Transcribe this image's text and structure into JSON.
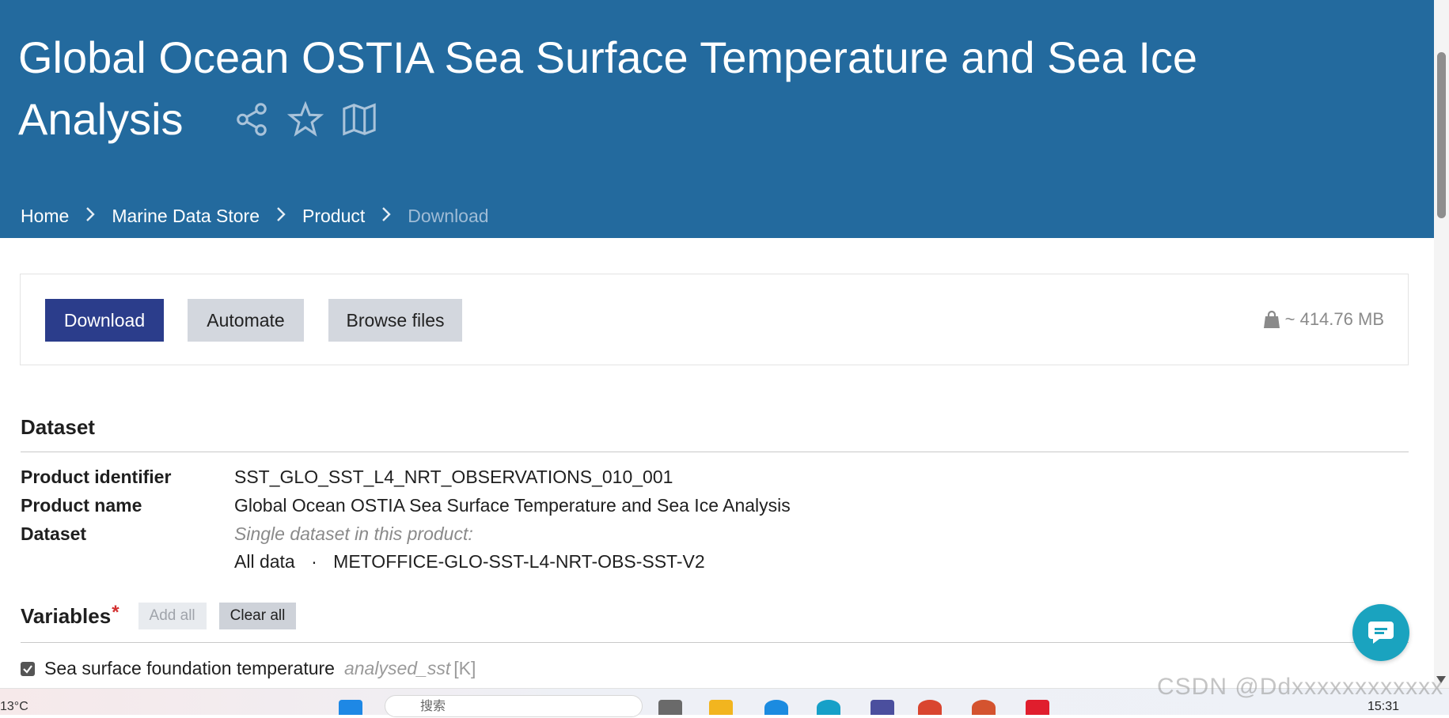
{
  "header": {
    "title_line1": "Global Ocean OSTIA Sea Surface Temperature and Sea Ice",
    "title_line2": "Analysis",
    "icons": [
      "share-icon",
      "star-icon",
      "map-icon"
    ],
    "breadcrumb": [
      "Home",
      "Marine Data Store",
      "Product",
      "Download"
    ],
    "bg_color": "#236a9e"
  },
  "actions": {
    "download_label": "Download",
    "automate_label": "Automate",
    "browse_label": "Browse files",
    "size_label": "~ 414.76 MB",
    "primary_color": "#2b3d8b"
  },
  "dataset": {
    "heading": "Dataset",
    "product_identifier_label": "Product identifier",
    "product_identifier": "SST_GLO_SST_L4_NRT_OBSERVATIONS_010_001",
    "product_name_label": "Product name",
    "product_name": "Global Ocean OSTIA Sea Surface Temperature and Sea Ice Analysis",
    "dataset_label": "Dataset",
    "dataset_note": "Single dataset in this product:",
    "dataset_value_prefix": "All data",
    "dataset_separator": "·",
    "dataset_value": "METOFFICE-GLO-SST-L4-NRT-OBS-SST-V2"
  },
  "variables": {
    "heading": "Variables",
    "required_mark": "*",
    "add_all_label": "Add all",
    "clear_all_label": "Clear all",
    "items": [
      {
        "label": "Sea surface foundation temperature",
        "code": "analysed_sst",
        "unit": "[K]",
        "checked": true
      }
    ]
  },
  "taskbar": {
    "temperature": "13°C",
    "search_placeholder": "搜索",
    "time": "15:31"
  },
  "watermark": "CSDN @Ddxxxxxxxxxxxx"
}
